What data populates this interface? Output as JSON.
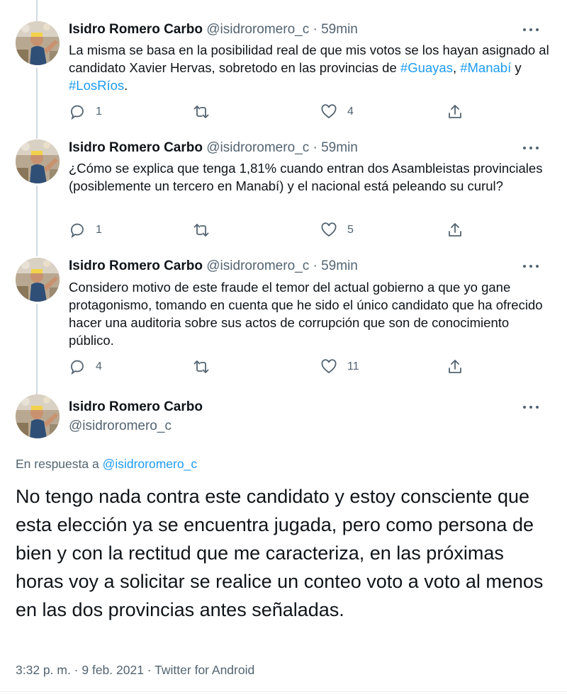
{
  "author": {
    "name": "Isidro Romero Carbo",
    "handle": "@isidroromero_c"
  },
  "thread": [
    {
      "time": "59min",
      "separator": "·",
      "text_parts": [
        "La misma se basa en la posibilidad real de que mis votos se los hayan asignado al candidato Xavier Hervas, sobretodo en las provincias de ",
        "#Guayas",
        ", ",
        "#Manabí",
        " y ",
        "#LosRíos",
        "."
      ],
      "replies": "1",
      "retweets": "",
      "likes": "4"
    },
    {
      "time": "59min",
      "separator": "·",
      "text": "¿Cómo se explica que tenga 1,81% cuando entran dos Asambleistas provinciales (posiblemente un tercero en Manabí) y el nacional está peleando su curul?",
      "replies": "1",
      "retweets": "",
      "likes": "5"
    },
    {
      "time": "59min",
      "separator": "·",
      "text": "Considero motivo de este fraude el temor del actual gobierno a que yo gane protagonismo, tomando en cuenta que he sido el único candidato que ha ofrecido hacer una auditoria sobre sus actos de corrupción que son de conocimiento público.",
      "replies": "4",
      "retweets": "",
      "likes": "11"
    }
  ],
  "main_tweet": {
    "reply_prefix": "En respuesta a ",
    "reply_to": "@isidroromero_c",
    "text": "No tengo nada contra este candidato y estoy consciente que esta elección ya se encuentra jugada, pero como persona de bien y con la rectitud que me caracteriza, en las próximas horas voy a solicitar se realice un conteo voto a voto al menos en las dos provincias antes señaladas.",
    "meta": "3:32 p. m. · 9 feb. 2021 · Twitter for Android"
  },
  "icons": {
    "reply": "reply-icon",
    "retweet": "retweet-icon",
    "like": "heart-icon",
    "share": "share-icon",
    "more": "more-icon"
  },
  "colors": {
    "link": "#1d9bf0",
    "muted": "#536471",
    "text": "#0f1419",
    "thread_line": "#cfd9de"
  }
}
